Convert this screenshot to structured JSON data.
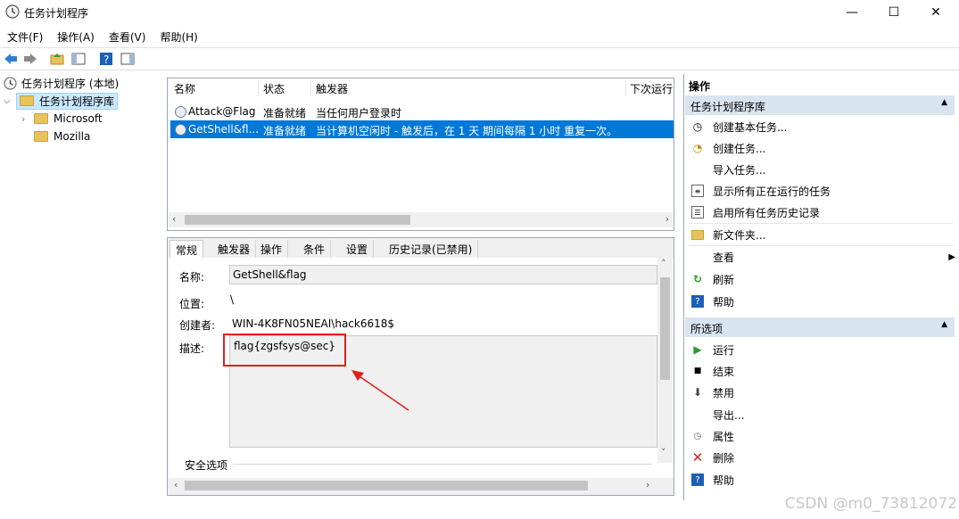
{
  "window": {
    "title": "任务计划程序",
    "minimize": "—",
    "maximize": "☐",
    "close": "✕"
  },
  "menu": [
    "文件(F)",
    "操作(A)",
    "查看(V)",
    "帮助(H)"
  ],
  "tree": {
    "root": "任务计划程序 (本地)",
    "library": "任务计划程序库",
    "children": [
      "Microsoft",
      "Mozilla"
    ]
  },
  "task_list": {
    "columns": [
      "名称",
      "状态",
      "触发器",
      "下次运行"
    ],
    "rows": [
      {
        "name": "Attack@Flag",
        "status": "准备就绪",
        "trigger": "当任何用户登录时"
      },
      {
        "name": "GetShell&fl...",
        "status": "准备就绪",
        "trigger": "当计算机空闲时 - 触发后，在 1 天 期间每隔 1 小时 重复一次。"
      }
    ]
  },
  "tabs": [
    "常规",
    "触发器",
    "操作",
    "条件",
    "设置",
    "历史记录(已禁用)"
  ],
  "details": {
    "name_label": "名称:",
    "name_value": "GetShell&flag",
    "location_label": "位置:",
    "location_value": "\\",
    "author_label": "创建者:",
    "author_value": "WIN-4K8FN05NEAI\\hack6618$",
    "desc_label": "描述:",
    "desc_value": "flag{zgsfsys@sec}",
    "security_label": "安全选项"
  },
  "actions": {
    "header": "操作",
    "section1": "任务计划程序库",
    "items1": [
      "创建基本任务...",
      "创建任务...",
      "导入任务...",
      "显示所有正在运行的任务",
      "启用所有任务历史记录",
      "新文件夹...",
      "查看",
      "刷新",
      "帮助"
    ],
    "section2": "所选项",
    "items2": [
      "运行",
      "结束",
      "禁用",
      "导出...",
      "属性",
      "删除",
      "帮助"
    ]
  },
  "watermark": "CSDN @m0_73812072",
  "colors": {
    "selection": "#0078d7",
    "annotation": "#e02020",
    "section_bg": "#d9e4f1"
  }
}
